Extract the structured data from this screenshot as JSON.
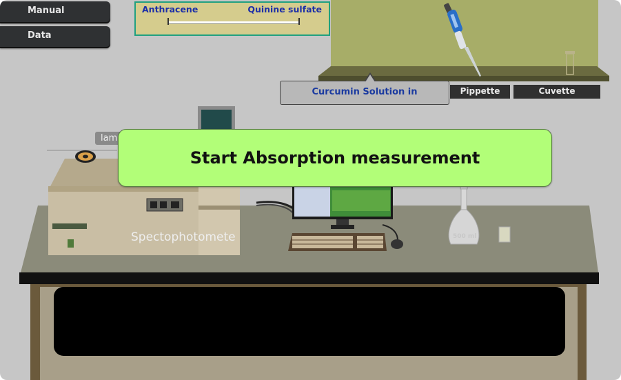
{
  "nav": {
    "manual_label": "Manual",
    "data_label": "Data"
  },
  "solution_selector": {
    "left_label": "Anthracene",
    "right_label": "Quinine sulfate"
  },
  "shelf": {
    "callout_label": "Curcumin Solution in",
    "pipette_label": "Pippette",
    "cuvette_label": "Cuvette"
  },
  "instrument": {
    "lamp_label": "lam",
    "spectrophotometer_label": "Spectophotometer"
  },
  "flask": {
    "volume_label": "500 ml"
  },
  "action": {
    "start_label": "Start Absorption measurement"
  },
  "colors": {
    "start_button": "#b2fe78",
    "slider_panel": "#d5cc8d",
    "slider_border": "#20a080",
    "label_blue": "#1d2fa8",
    "shelf": "#a7ad68",
    "bench_top": "#8b8b7a",
    "nav_button": "#2f3133"
  }
}
